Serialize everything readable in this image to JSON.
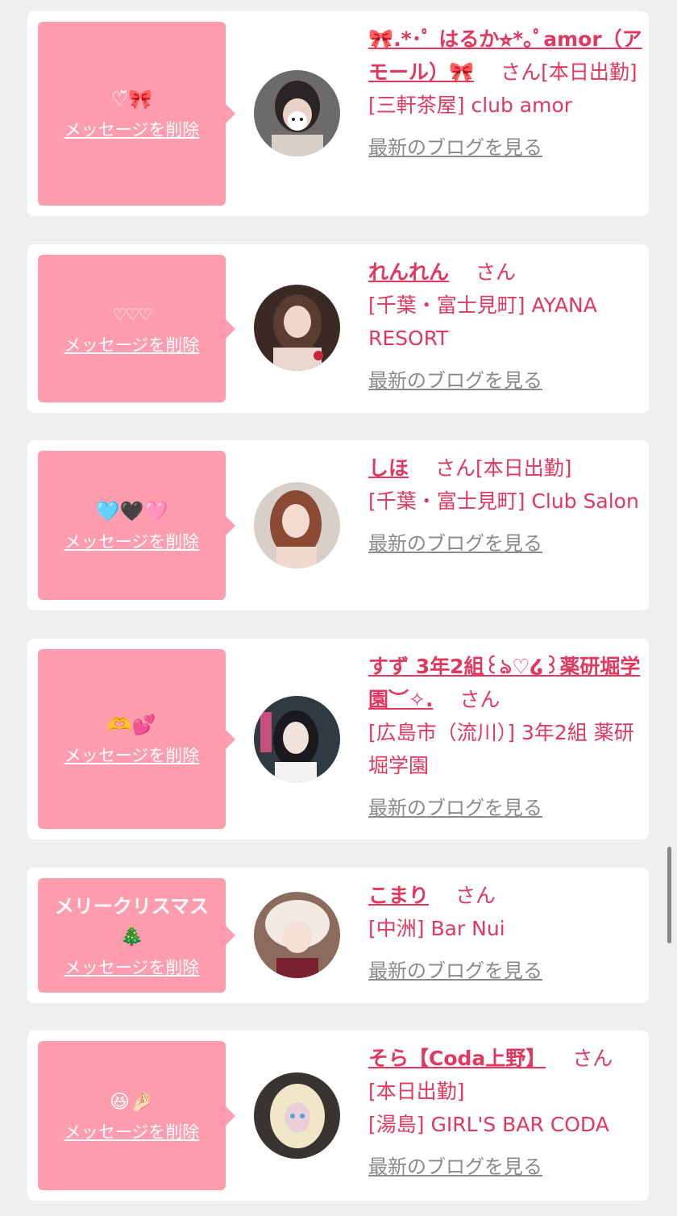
{
  "delete_label": "メッセージを削除",
  "blog_label": "最新のブログを見る",
  "san": "さん",
  "entries": [
    {
      "message": "♡̆̈🎀",
      "name": "🎀.*･ﾟ はるか⭐︎*｡ﾟamor（アモール）🎀",
      "status": "[本日出勤]",
      "shop": "[三軒茶屋] club amor"
    },
    {
      "message": "♡♡♡",
      "name": "れんれん",
      "status": "",
      "shop": "[千葉・富士見町] AYANA RESORT"
    },
    {
      "message": "🩵🖤🩷",
      "name": "しほ",
      "status": "[本日出勤]",
      "shop": "[千葉・富士見町] Club Salon"
    },
    {
      "message": "🫶💕",
      "name": "すず 3年2組꒰ঌ♡໒꒱薬研堀学園︶✧.",
      "status": "",
      "shop": "[広島市（流川）] 3年2組 薬研堀学園"
    },
    {
      "message": "メリークリスマス🎄",
      "name": "こまり",
      "status": "",
      "shop": "[中洲] Bar Nui"
    },
    {
      "message": "😆🤌🏻",
      "name": "そら【Coda上野】",
      "status": "[本日出勤]",
      "shop": "[湯島] GIRL'S BAR CODA"
    }
  ],
  "colors": {
    "accent": "#e0385f",
    "bubble": "#ff9cae",
    "link_gray": "#8a8a8a",
    "background": "#efefef"
  }
}
